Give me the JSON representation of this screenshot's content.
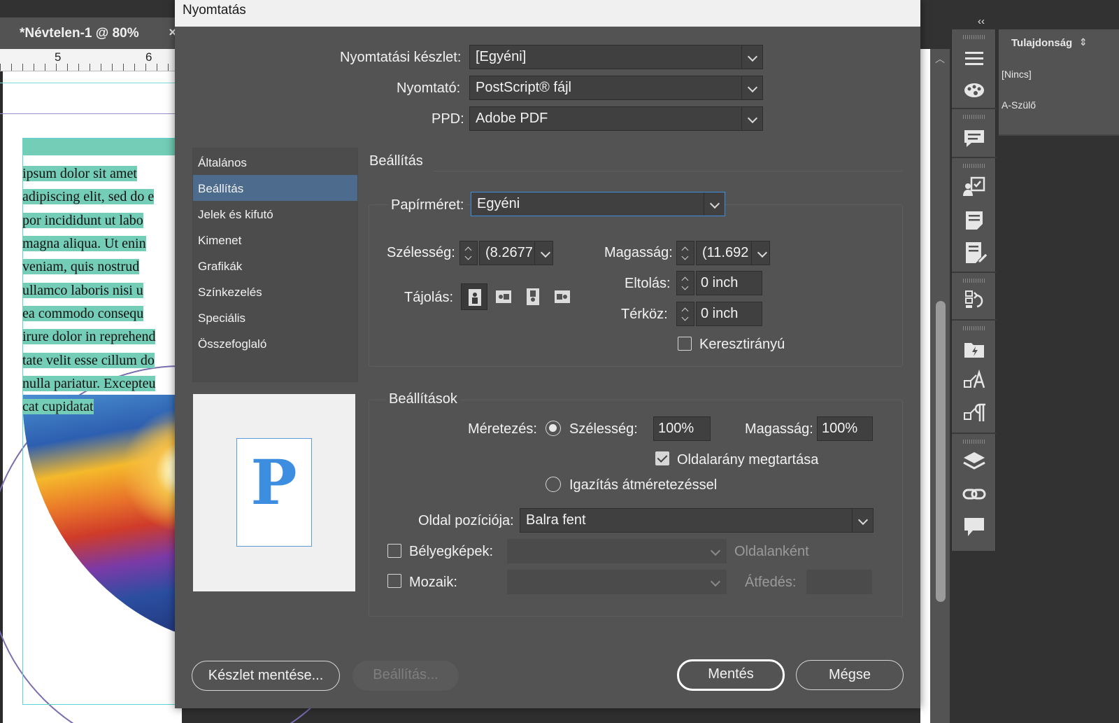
{
  "document": {
    "tab_title": "*Névtelen-1 @ 80%",
    "close_glyph": "×",
    "ruler_labels": [
      "5",
      "6"
    ],
    "text_lines": [
      "ipsum dolor sit amet",
      "adipiscing elit, sed do e",
      "por incididunt ut labo",
      "magna aliqua. Ut enin",
      "veniam, quis nostrud",
      "ullamco laboris nisi u",
      "ea commodo consequ",
      "irure dolor in reprehend",
      "tate velit esse cillum do",
      "nulla pariatur. Excepteu",
      "cat cupidatat"
    ]
  },
  "right_panel": {
    "collapse_icon": "double-chevron-left-icon",
    "properties_tab": "Tulajdonság",
    "items": [
      "[Nincs]",
      "A-Szülő"
    ],
    "icons": [
      "menu-icon",
      "swatches-icon",
      "comments-icon",
      "review-icon",
      "notes-icon",
      "edit-notes-icon",
      "paragraph-styles-icon",
      "cc-libraries-icon",
      "character-styles-icon",
      "paragraph-icon",
      "layers-icon",
      "links-icon",
      "chat-icon"
    ]
  },
  "dialog": {
    "title": "Nyomtatás",
    "preset_label": "Nyomtatási készlet:",
    "preset_value": "[Egyéni]",
    "printer_label": "Nyomtató:",
    "printer_value": "PostScript® fájl",
    "ppd_label": "PPD:",
    "ppd_value": "Adobe PDF",
    "nav": [
      "Általános",
      "Beállítás",
      "Jelek és kifutó",
      "Kimenet",
      "Grafikák",
      "Színkezelés",
      "Speciális",
      "Összefoglaló"
    ],
    "active_nav_index": 1,
    "preview_letter": "P",
    "setup": {
      "title": "Beállítás",
      "paper_size_label": "Papírméret:",
      "paper_size_value": "Egyéni",
      "width_label": "Szélesség:",
      "width_value": "(8.2677",
      "height_label": "Magasság:",
      "height_value": "(11.692",
      "orientation_label": "Tájolás:",
      "offset_label": "Eltolás:",
      "offset_value": "0 inch",
      "gap_label": "Térköz:",
      "gap_value": "0 inch",
      "transverse_label": "Keresztirányú",
      "transverse_checked": false
    },
    "options": {
      "title": "Beállítások",
      "scale_label": "Méretezés:",
      "scale_width_label": "Szélesség:",
      "scale_width_value": "100%",
      "scale_height_label": "Magasság:",
      "scale_height_value": "100%",
      "keep_ratio_label": "Oldalarány megtartása",
      "keep_ratio_checked": true,
      "fit_label": "Igazítás átméretezéssel",
      "page_position_label": "Oldal pozíciója:",
      "page_position_value": "Balra fent",
      "thumbnails_label": "Bélyegképek:",
      "thumbnails_suffix": "Oldalanként",
      "tile_label": "Mozaik:",
      "overlap_label": "Átfedés:"
    },
    "buttons": {
      "save_preset": "Készlet mentése...",
      "setup": "Beállítás...",
      "save": "Mentés",
      "cancel": "Mégse"
    }
  }
}
